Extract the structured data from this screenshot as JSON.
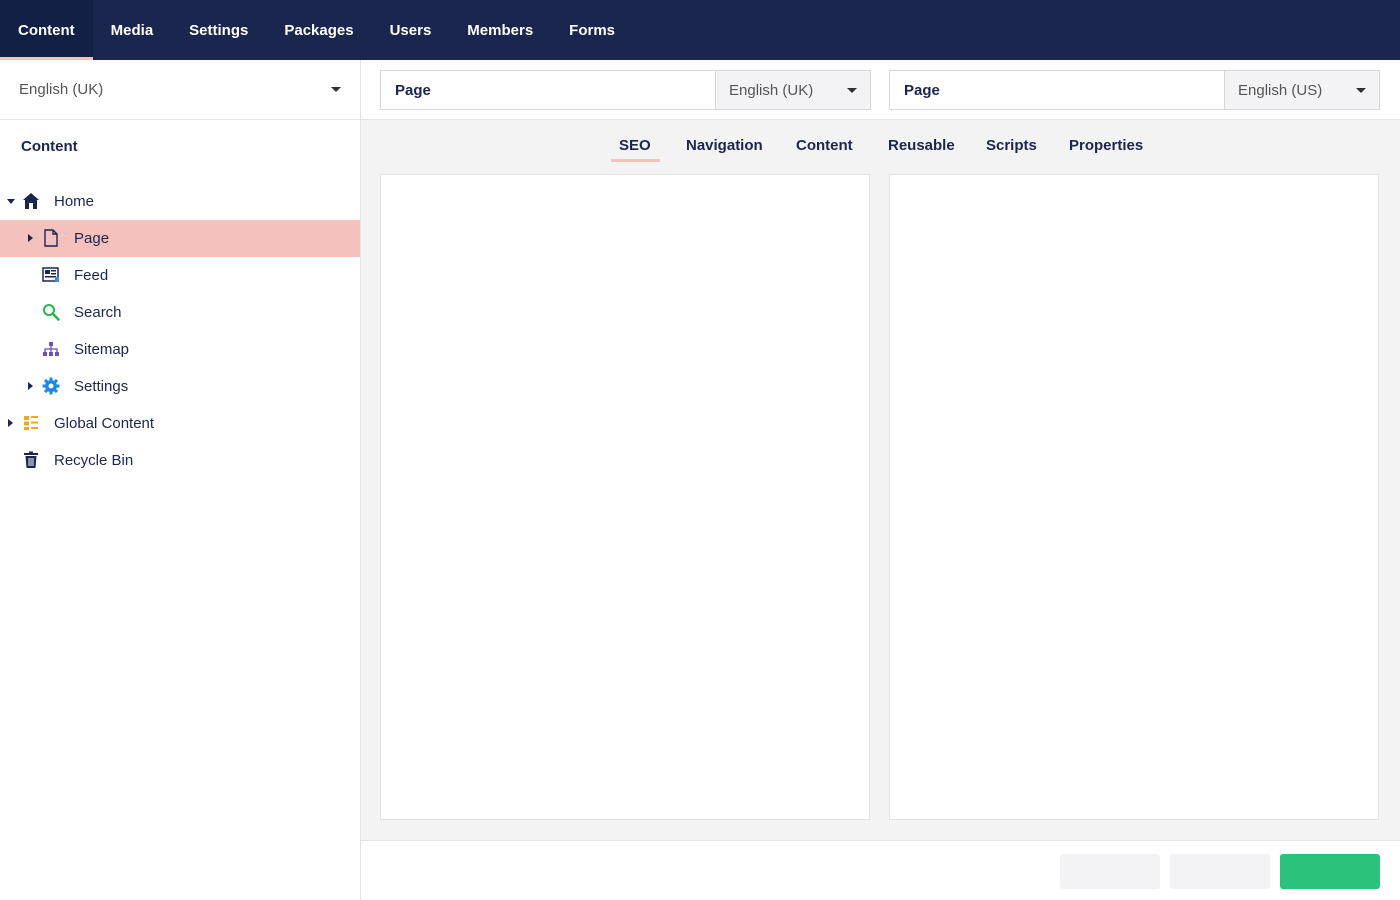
{
  "topnav": {
    "tabs": [
      "Content",
      "Media",
      "Settings",
      "Packages",
      "Users",
      "Members",
      "Forms"
    ]
  },
  "sidebar": {
    "language": "English (UK)",
    "heading": "Content",
    "tree": [
      {
        "label": "Home",
        "icon": "home-icon"
      },
      {
        "label": "Page",
        "icon": "document-icon"
      },
      {
        "label": "Feed",
        "icon": "feed-icon"
      },
      {
        "label": "Search",
        "icon": "search-icon"
      },
      {
        "label": "Sitemap",
        "icon": "sitemap-icon"
      },
      {
        "label": "Settings",
        "icon": "gear-icon"
      },
      {
        "label": "Global Content",
        "icon": "grid-list-icon"
      },
      {
        "label": "Recycle Bin",
        "icon": "trash-icon"
      }
    ]
  },
  "editor": {
    "left": {
      "name": "Page",
      "language": "English (UK)"
    },
    "right": {
      "name": "Page",
      "language": "English (US)"
    },
    "tabs": [
      "SEO",
      "Navigation",
      "Content",
      "Reusable",
      "Scripts",
      "Properties"
    ],
    "active_tab": "SEO"
  },
  "colors": {
    "nav_bg": "#1b264f",
    "accent_pink": "#f5c1bc",
    "primary_green": "#2bc37c",
    "panel_bg": "#f4f3f3"
  }
}
